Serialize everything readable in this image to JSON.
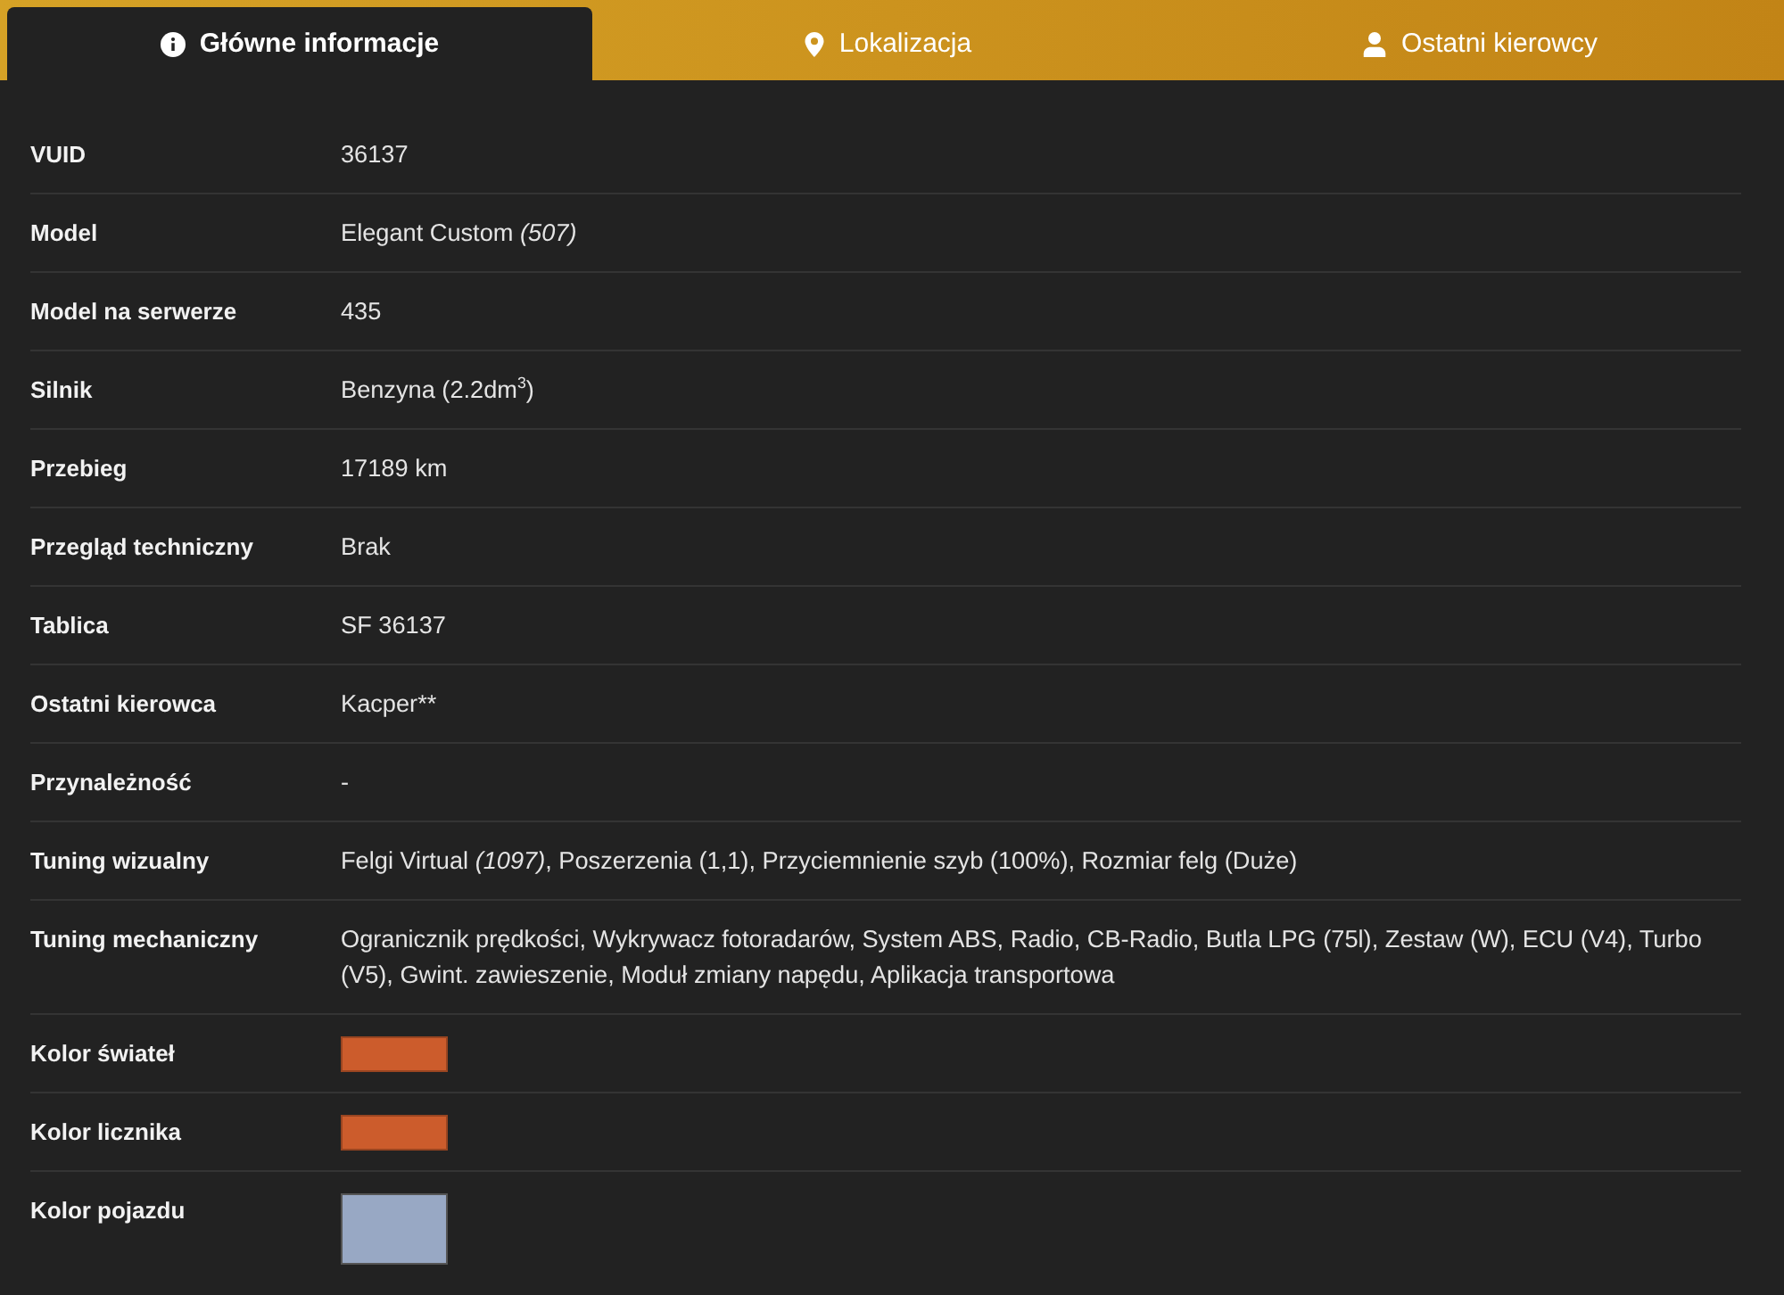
{
  "tabs": [
    {
      "label": "Główne informacje",
      "selected": true
    },
    {
      "label": "Lokalizacja",
      "selected": false
    },
    {
      "label": "Ostatni kierowcy",
      "selected": false
    }
  ],
  "details": [
    {
      "label": "VUID",
      "kind": "text",
      "value": "36137"
    },
    {
      "label": "Model",
      "kind": "text",
      "value": "Elegant Custom *(507)*"
    },
    {
      "label": "Model na serwerze",
      "kind": "text",
      "value": "435"
    },
    {
      "label": "Silnik",
      "kind": "text",
      "value": "Benzyna (2.2dm$^{3}$)"
    },
    {
      "label": "Przebieg",
      "kind": "text",
      "value": "17189 km"
    },
    {
      "label": "Przegląd techniczny",
      "kind": "text",
      "value": "Brak"
    },
    {
      "label": "Tablica",
      "kind": "text",
      "value": "SF 36137"
    },
    {
      "label": "Ostatni kierowca",
      "kind": "text",
      "value": "Kacper**"
    },
    {
      "label": "Przynależność",
      "kind": "text",
      "value": "-"
    },
    {
      "label": "Tuning wizualny",
      "kind": "text",
      "value": "Felgi Virtual *(1097)*, Poszerzenia (1,1), Przyciemnienie szyb (100%), Rozmiar felg (Duże)"
    },
    {
      "label": "Tuning mechaniczny",
      "kind": "text",
      "value": "Ogranicznik prędkości, Wykrywacz fotoradarów, System ABS, Radio, CB-Radio, Butla LPG (75l), Zestaw (W), ECU (V4), Turbo (V5), Gwint. zawieszenie, Moduł zmiany napędu, Aplikacja transportowa"
    },
    {
      "label": "Kolor świateł",
      "kind": "color",
      "color": "#cc5c2c"
    },
    {
      "label": "Kolor licznika",
      "kind": "color",
      "color": "#cc5c2c"
    },
    {
      "label": "Kolor pojazdu",
      "kind": "paint",
      "color": "#98a8c4"
    }
  ]
}
